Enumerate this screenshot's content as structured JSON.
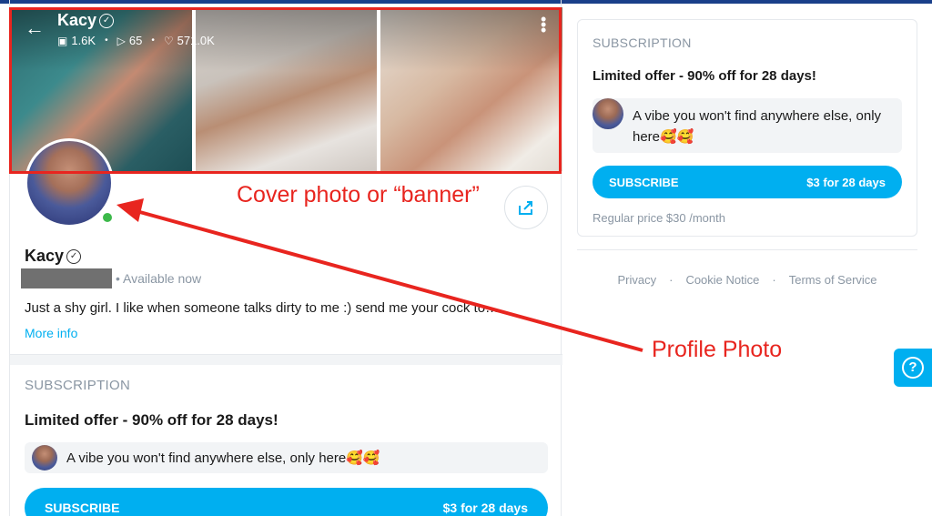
{
  "profile": {
    "name": "Kacy",
    "stats": {
      "media": "1.6K",
      "videos": "65",
      "likes": "571.0K"
    },
    "availability": "Available now",
    "bio": "Just a shy girl. I like when someone talks dirty to me :) send me your cock to…",
    "more_info": "More info"
  },
  "subscription": {
    "label": "SUBSCRIPTION",
    "offer": "Limited offer - 90% off for 28 days!",
    "message": "A vibe you won't find anywhere else, only here🥰🥰",
    "button_label": "SUBSCRIBE",
    "button_price": "$3 for 28 days",
    "regular_price": "Regular price $30 /month"
  },
  "footer": {
    "links": [
      "Privacy",
      "Cookie Notice",
      "Terms of Service"
    ]
  },
  "annotations": {
    "banner": "Cover photo or “banner”",
    "profile_photo": "Profile Photo"
  },
  "colors": {
    "accent": "#00aff0",
    "annotation": "#e8251f",
    "online": "#3cb94a"
  },
  "icons": {
    "back": "back-arrow-icon",
    "verified": "verified-icon",
    "share": "share-icon",
    "help": "help-icon"
  }
}
